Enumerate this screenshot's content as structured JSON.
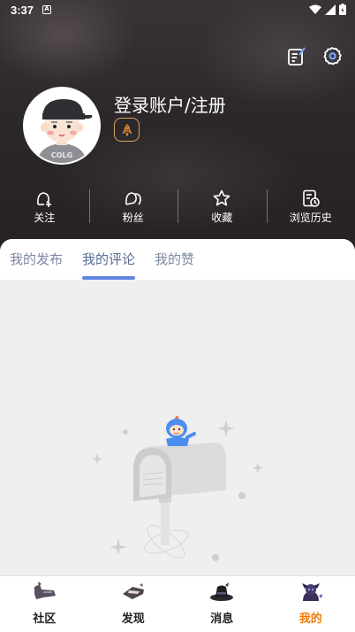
{
  "status_bar": {
    "time": "3:37",
    "app_letter": "A"
  },
  "profile": {
    "username": "登录账户/注册"
  },
  "stats": [
    {
      "label": "关注",
      "icon": "follow-icon"
    },
    {
      "label": "粉丝",
      "icon": "fans-icon"
    },
    {
      "label": "收藏",
      "icon": "star-icon"
    },
    {
      "label": "浏览历史",
      "icon": "history-icon"
    }
  ],
  "tabs": [
    {
      "label": "我的发布",
      "active": false
    },
    {
      "label": "我的评论",
      "active": true
    },
    {
      "label": "我的赞",
      "active": false
    }
  ],
  "avatar_shirt_text": "COLG",
  "bottom_nav": [
    {
      "label": "社区",
      "icon": "community-icon",
      "active": false
    },
    {
      "label": "发现",
      "icon": "discover-icon",
      "active": false
    },
    {
      "label": "消息",
      "icon": "message-icon",
      "active": false
    },
    {
      "label": "我的",
      "icon": "mine-icon",
      "active": true
    }
  ],
  "colors": {
    "accent": "#f27a06",
    "tab_indicator": "#5f86e3",
    "badge_border": "#d9a25b"
  }
}
